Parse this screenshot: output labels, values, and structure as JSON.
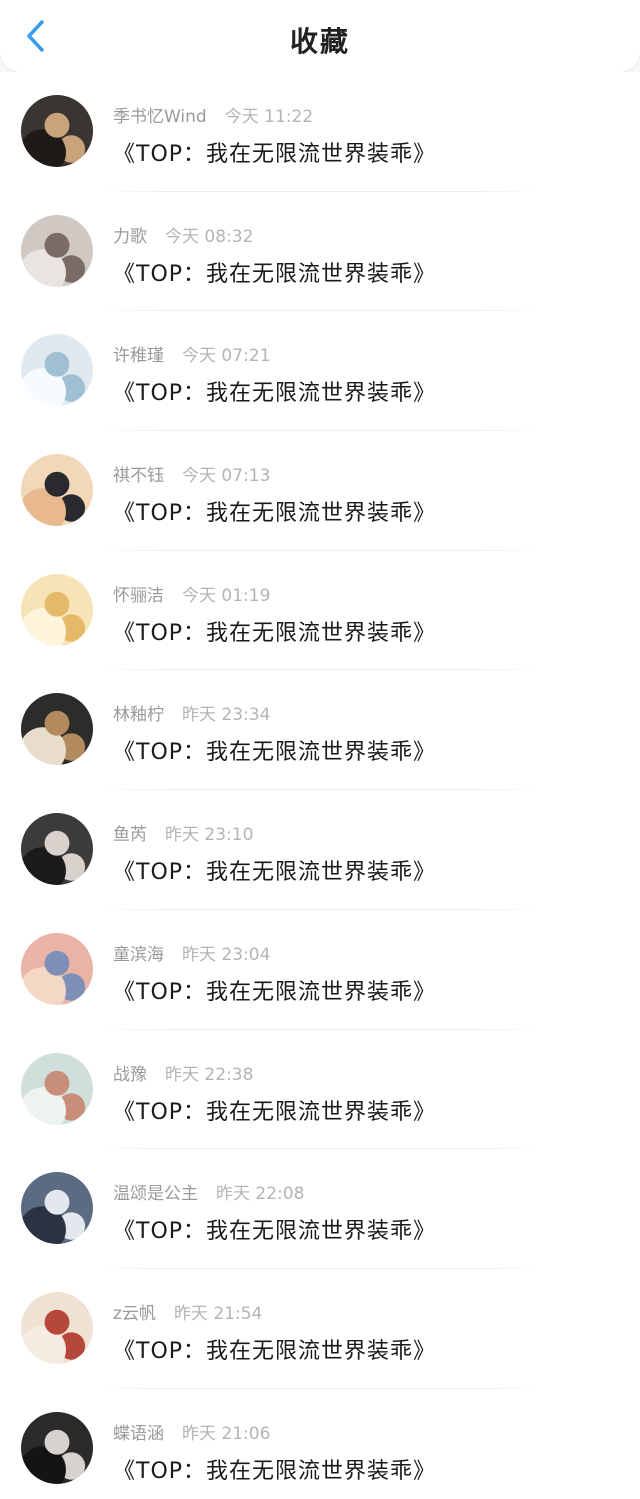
{
  "header": {
    "title": "收藏",
    "back_icon": "chevron-left-icon",
    "accent_color": "#3a9bf0"
  },
  "items": [
    {
      "name": "季书忆Wind",
      "time": "今天 11:22",
      "work": "《TOP：我在无限流世界装乖》",
      "avatar_colors": [
        "#3a3530",
        "#c9a37a",
        "#1e1a17"
      ]
    },
    {
      "name": "力歌",
      "time": "今天 08:32",
      "work": "《TOP：我在无限流世界装乖》",
      "avatar_colors": [
        "#cfc8c3",
        "#7a6b66",
        "#e9e4e1"
      ]
    },
    {
      "name": "许稚瑾",
      "time": "今天 07:21",
      "work": "《TOP：我在无限流世界装乖》",
      "avatar_colors": [
        "#dfe9ef",
        "#9fbfd3",
        "#f7fbfd"
      ]
    },
    {
      "name": "祺不钰",
      "time": "今天 07:13",
      "work": "《TOP：我在无限流世界装乖》",
      "avatar_colors": [
        "#f2d8b8",
        "#2a2a2e",
        "#e8b98e"
      ]
    },
    {
      "name": "怀骊洁",
      "time": "今天 01:19",
      "work": "《TOP：我在无限流世界装乖》",
      "avatar_colors": [
        "#f6e3b6",
        "#e5b96a",
        "#fff4dc"
      ]
    },
    {
      "name": "林釉柠",
      "time": "昨天 23:34",
      "work": "《TOP：我在无限流世界装乖》",
      "avatar_colors": [
        "#2c2c2a",
        "#b28a5e",
        "#e8dccb"
      ]
    },
    {
      "name": "鱼芮",
      "time": "昨天 23:10",
      "work": "《TOP：我在无限流世界装乖》",
      "avatar_colors": [
        "#3b3b3b",
        "#d9d2cc",
        "#1b1b1b"
      ]
    },
    {
      "name": "童滨海",
      "time": "昨天 23:04",
      "work": "《TOP：我在无限流世界装乖》",
      "avatar_colors": [
        "#e9b4a6",
        "#7e8fb8",
        "#f4d7c4"
      ]
    },
    {
      "name": "战豫",
      "time": "昨天 22:38",
      "work": "《TOP：我在无限流世界装乖》",
      "avatar_colors": [
        "#cfe0dc",
        "#c98e7a",
        "#eef4f2"
      ]
    },
    {
      "name": "温颂是公主",
      "time": "昨天 22:08",
      "work": "《TOP：我在无限流世界装乖》",
      "avatar_colors": [
        "#5a6b82",
        "#e3e7ee",
        "#2b3342"
      ]
    },
    {
      "name": "z云帆",
      "time": "昨天 21:54",
      "work": "《TOP：我在无限流世界装乖》",
      "avatar_colors": [
        "#efe2d2",
        "#b5483a",
        "#f6ede2"
      ]
    },
    {
      "name": "蝶语涵",
      "time": "昨天 21:06",
      "work": "《TOP：我在无限流世界装乖》",
      "avatar_colors": [
        "#2a2a2a",
        "#d7d2cd",
        "#141414"
      ]
    }
  ]
}
